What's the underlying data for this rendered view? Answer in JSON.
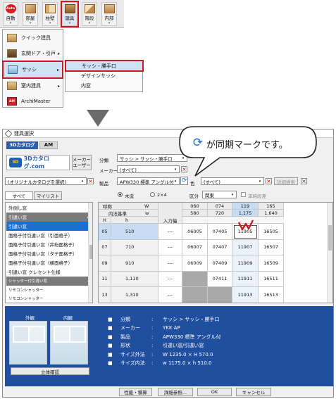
{
  "toolbar": {
    "items": [
      {
        "label": "自動",
        "badge": "Auto"
      },
      {
        "label": "部屋"
      },
      {
        "label": "柱壁"
      },
      {
        "label": "建具"
      },
      {
        "label": "階段"
      },
      {
        "label": "内部"
      }
    ]
  },
  "menu_main": {
    "items": [
      {
        "label": "クイック建具"
      },
      {
        "label": "玄関ドア・引戸"
      },
      {
        "label": "サッシ"
      },
      {
        "label": "室内建具"
      },
      {
        "label": "ArchiMaster",
        "badge": "AM"
      }
    ]
  },
  "menu_sub": {
    "items": [
      {
        "label": "サッシ・勝手口"
      },
      {
        "label": "デザインサッシ"
      },
      {
        "label": "内窓"
      }
    ]
  },
  "callout": {
    "text": "が同期マークです。"
  },
  "dialog": {
    "title": "建具選択",
    "help": "?",
    "tab_3d": "3Dカタログ",
    "tab_am": "AM",
    "logo_text": "3Dカタログ.com",
    "maker_user_btn": "メーカー\nユーザー",
    "bunrui_label": "分類",
    "bunrui_value": "サッシ > サッシ・勝手口",
    "maker_label": "メーカー",
    "maker_value": "(すべて)",
    "catalog_value": "(オリジナルカタログを選択)",
    "product_label": "製品",
    "product_value": "APW330 標準 アングル付",
    "color_label": "色",
    "color_value": "(すべて)",
    "detail_search": "詳細検索",
    "tab_all": "すべて",
    "tab_mylist": "マイリスト",
    "radio_kidate": "木造",
    "radio_2x4": "2×4",
    "kubun_label": "区分",
    "kubun_value": "関東",
    "single_glass": "単純段差",
    "list": [
      {
        "label": "外倒し窓",
        "type": "item"
      },
      {
        "label": "引違い窓",
        "type": "header"
      },
      {
        "label": "引違い窓",
        "type": "selected"
      },
      {
        "label": "面格子付引違い窓（引面格子）",
        "type": "item"
      },
      {
        "label": "面格子付引違い窓（井桁面格子）",
        "type": "item"
      },
      {
        "label": "面格子付引違い窓（タテ面格子）",
        "type": "item"
      },
      {
        "label": "面格子付引違い窓（横面格子）",
        "type": "item"
      },
      {
        "label": "引違い窓 クレセント仕様",
        "type": "item"
      },
      {
        "label": "シャッター付引違い窓",
        "type": "header"
      },
      {
        "label": "リモコンシャッター",
        "type": "item"
      },
      {
        "label": "リモコンシャッター",
        "type": "item"
      }
    ],
    "grid": {
      "head_row1": [
        "呼称",
        "W",
        "060",
        "074",
        "119",
        "165"
      ],
      "head_row2": [
        "内法基準",
        "w",
        "580",
        "720",
        "1,175",
        "1,640"
      ],
      "head_row3": [
        "H",
        "h",
        "入力幅"
      ],
      "rows": [
        {
          "code": "05",
          "h": "510",
          "input": "---",
          "c1": "06005",
          "c2": "07405",
          "c3": "11905",
          "c4": "16505"
        },
        {
          "code": "07",
          "h": "710",
          "input": "---",
          "c1": "06007",
          "c2": "07407",
          "c3": "11907",
          "c4": "16507"
        },
        {
          "code": "09",
          "h": "910",
          "input": "---",
          "c1": "06009",
          "c2": "07409",
          "c3": "11909",
          "c4": "16509"
        },
        {
          "code": "11",
          "h": "1,110",
          "input": "---",
          "c1": "",
          "c2": "07411",
          "c3": "11911",
          "c4": "16511"
        },
        {
          "code": "13",
          "h": "1,310",
          "input": "---",
          "c1": "",
          "c2": "",
          "c3": "11913",
          "c4": "16513"
        }
      ]
    },
    "preview": {
      "outside": "外観",
      "inside": "内観",
      "btn_3d": "立体確認"
    },
    "info": [
      {
        "key": "分類",
        "value": "サッシ > サッシ・勝手口"
      },
      {
        "key": "メーカー",
        "value": "YKK AP"
      },
      {
        "key": "製品",
        "value": "APW330 標準 アングル付"
      },
      {
        "key": "形状",
        "value": "引違い窓/引違い窓"
      },
      {
        "key": "サイズ外法",
        "value": "W 1235.0 × H 570.0"
      },
      {
        "key": "サイズ内法",
        "value": "w 1175.0 × h 510.0"
      }
    ],
    "footer": {
      "perf": "性能・積算",
      "detail_ref": "詳細参照...",
      "ok": "OK",
      "cancel": "キャンセル"
    }
  },
  "colors": {
    "highlight_red": "#d0161e",
    "info_blue": "#1f4f9e",
    "select_blue": "#1a6fd1"
  }
}
